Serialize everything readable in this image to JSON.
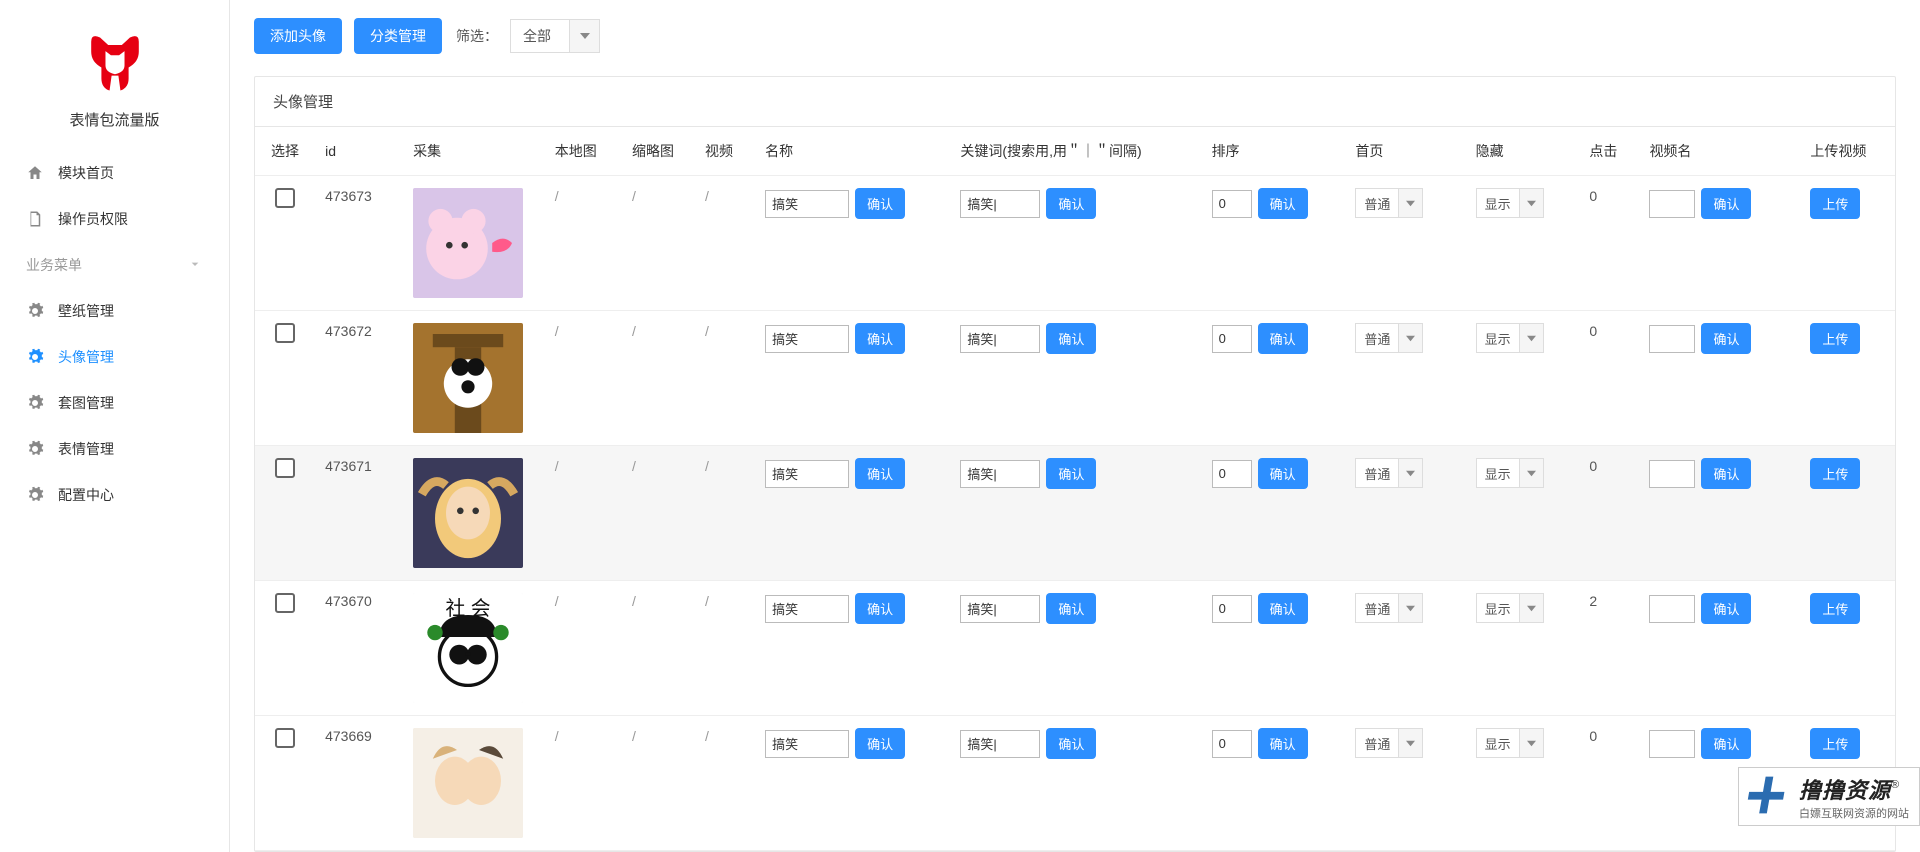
{
  "brand": "表情包流量版",
  "menu": {
    "home": "模块首页",
    "operator": "操作员权限",
    "section": "业务菜单",
    "items": [
      {
        "label": "壁纸管理"
      },
      {
        "label": "头像管理"
      },
      {
        "label": "套图管理"
      },
      {
        "label": "表情管理"
      },
      {
        "label": "配置中心"
      }
    ]
  },
  "toolbar": {
    "add": "添加头像",
    "category": "分类管理",
    "filter_label": "筛选：",
    "filter_value": "全部"
  },
  "panel_title": "头像管理",
  "columns": {
    "select": "选择",
    "id": "id",
    "caiji": "采集",
    "bendi": "本地图",
    "suolue": "缩略图",
    "shipin": "视频",
    "mingcheng": "名称",
    "guanjianci": "关键词(搜索用,用＂｜＂间隔)",
    "paixu": "排序",
    "shouye": "首页",
    "yincang": "隐藏",
    "dianji": "点击",
    "shipinming": "视频名",
    "upload": "上传视频"
  },
  "labels": {
    "confirm": "确认",
    "upload": "上传",
    "slash": "/",
    "normal": "普通",
    "show": "显示"
  },
  "rows": [
    {
      "id": "473673",
      "name": "搞笑",
      "keyword": "搞笑|",
      "sort": "0",
      "home": "普通",
      "hide": "显示",
      "clicks": "0",
      "videoName": ""
    },
    {
      "id": "473672",
      "name": "搞笑",
      "keyword": "搞笑|",
      "sort": "0",
      "home": "普通",
      "hide": "显示",
      "clicks": "0",
      "videoName": ""
    },
    {
      "id": "473671",
      "name": "搞笑",
      "keyword": "搞笑|",
      "sort": "0",
      "home": "普通",
      "hide": "显示",
      "clicks": "0",
      "videoName": "",
      "highlight": true
    },
    {
      "id": "473670",
      "name": "搞笑",
      "keyword": "搞笑|",
      "sort": "0",
      "home": "普通",
      "hide": "显示",
      "clicks": "2",
      "videoName": ""
    },
    {
      "id": "473669",
      "name": "搞笑",
      "keyword": "搞笑|",
      "sort": "0",
      "home": "普通",
      "hide": "显示",
      "clicks": "0",
      "videoName": ""
    }
  ],
  "watermark": {
    "title": "撸撸资源",
    "reg": "®",
    "sub": "白嫖互联网资源的网站"
  }
}
